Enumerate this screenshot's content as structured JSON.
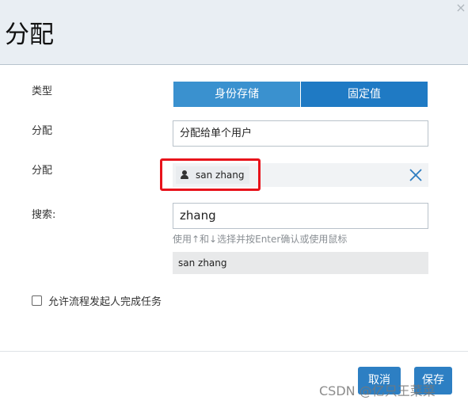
{
  "dialog": {
    "title": "分配",
    "close_glyph": "×"
  },
  "form": {
    "type_label": "类型",
    "type_options": [
      "身份存储",
      "固定值"
    ],
    "assign_label": "分配",
    "assign_value": "分配给单个用户",
    "assignee_label": "分配",
    "assignee_chip": "san zhang",
    "search_label": "搜索:",
    "search_value": "zhang",
    "search_hint": "使用↑和↓选择并按Enter确认或使用鼠标",
    "search_result": "san zhang",
    "checkbox_label": "允许流程发起人完成任务"
  },
  "footer": {
    "cancel_label": "取消",
    "save_label": "保存"
  },
  "watermark": "CSDN @亿只王菜菜",
  "colors": {
    "header_bg": "#e9eef3",
    "seg_active": "#3a91cf",
    "seg_inactive": "#1f7ac4",
    "button": "#2d7fc3",
    "highlight_box": "#e8131b",
    "remove_icon": "#2c7cc1"
  }
}
